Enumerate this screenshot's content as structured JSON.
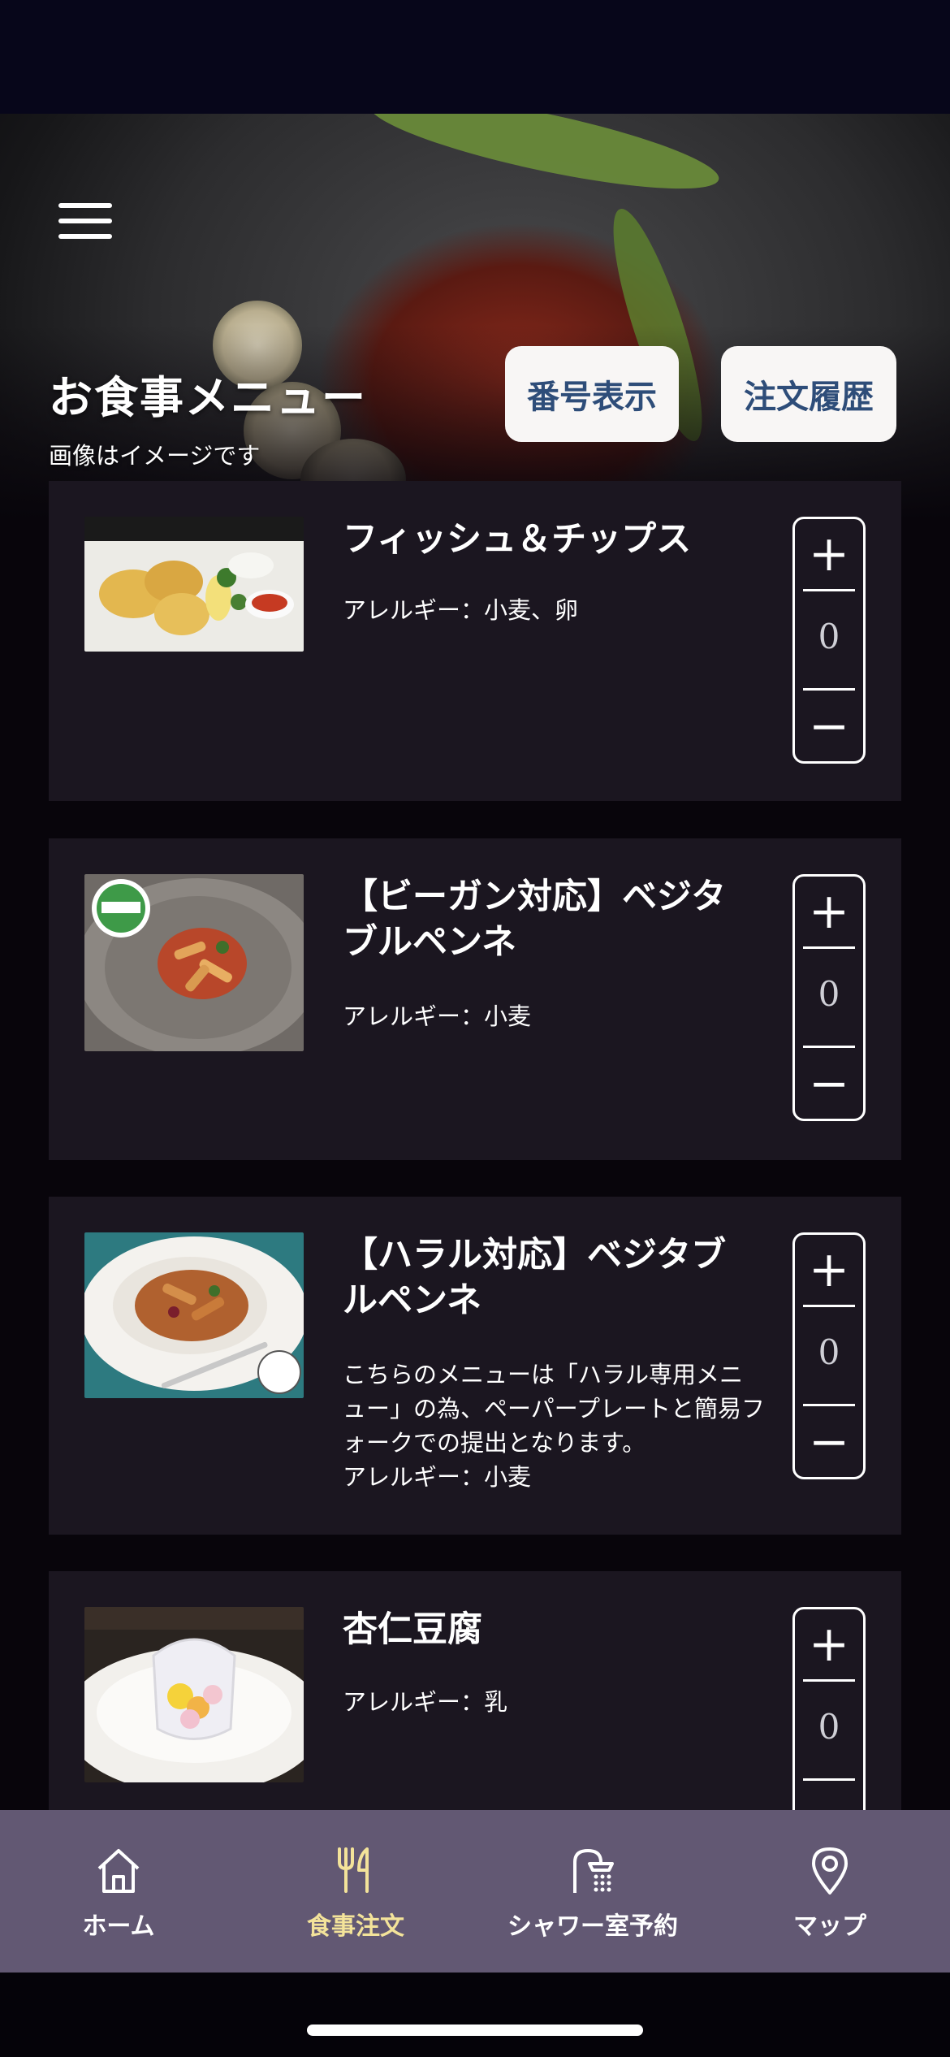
{
  "header": {
    "title": "お食事メニュー",
    "subtitle": "画像はイメージです",
    "number_button": "番号表示",
    "history_button": "注文履歴"
  },
  "menu_items": [
    {
      "name": "フィッシュ＆チップス",
      "description": "",
      "allergy": "アレルギー：小麦、卵",
      "quantity": "0",
      "plus": "+",
      "minus": "−"
    },
    {
      "name": "【ビーガン対応】ベジタブルペンネ",
      "description": "",
      "allergy": "アレルギー：小麦",
      "quantity": "0",
      "plus": "+",
      "minus": "−",
      "badge": "VEGAN"
    },
    {
      "name": "【ハラル対応】ベジタブルペンネ",
      "description": "こちらのメニューは「ハラル専用メニュー」の為、ペーパープレートと簡易フォークでの提出となります。",
      "allergy": "アレルギー：小麦",
      "quantity": "0",
      "plus": "+",
      "minus": "−",
      "badge": "HALAL"
    },
    {
      "name": "杏仁豆腐",
      "description": "",
      "allergy": "アレルギー：乳",
      "quantity": "0",
      "plus": "+",
      "minus": "−"
    }
  ],
  "tabs": [
    {
      "label": "ホーム",
      "icon": "home-icon",
      "active": false
    },
    {
      "label": "食事注文",
      "icon": "fork-knife-icon",
      "active": true
    },
    {
      "label": "シャワー室予約",
      "icon": "shower-icon",
      "active": false
    },
    {
      "label": "マップ",
      "icon": "map-pin-icon",
      "active": false
    }
  ],
  "colors": {
    "background": "#08050b",
    "card": "#1b1620",
    "tab_bar": "#625873",
    "active_tab": "#f3e39a",
    "button_text": "#2e4d79"
  }
}
